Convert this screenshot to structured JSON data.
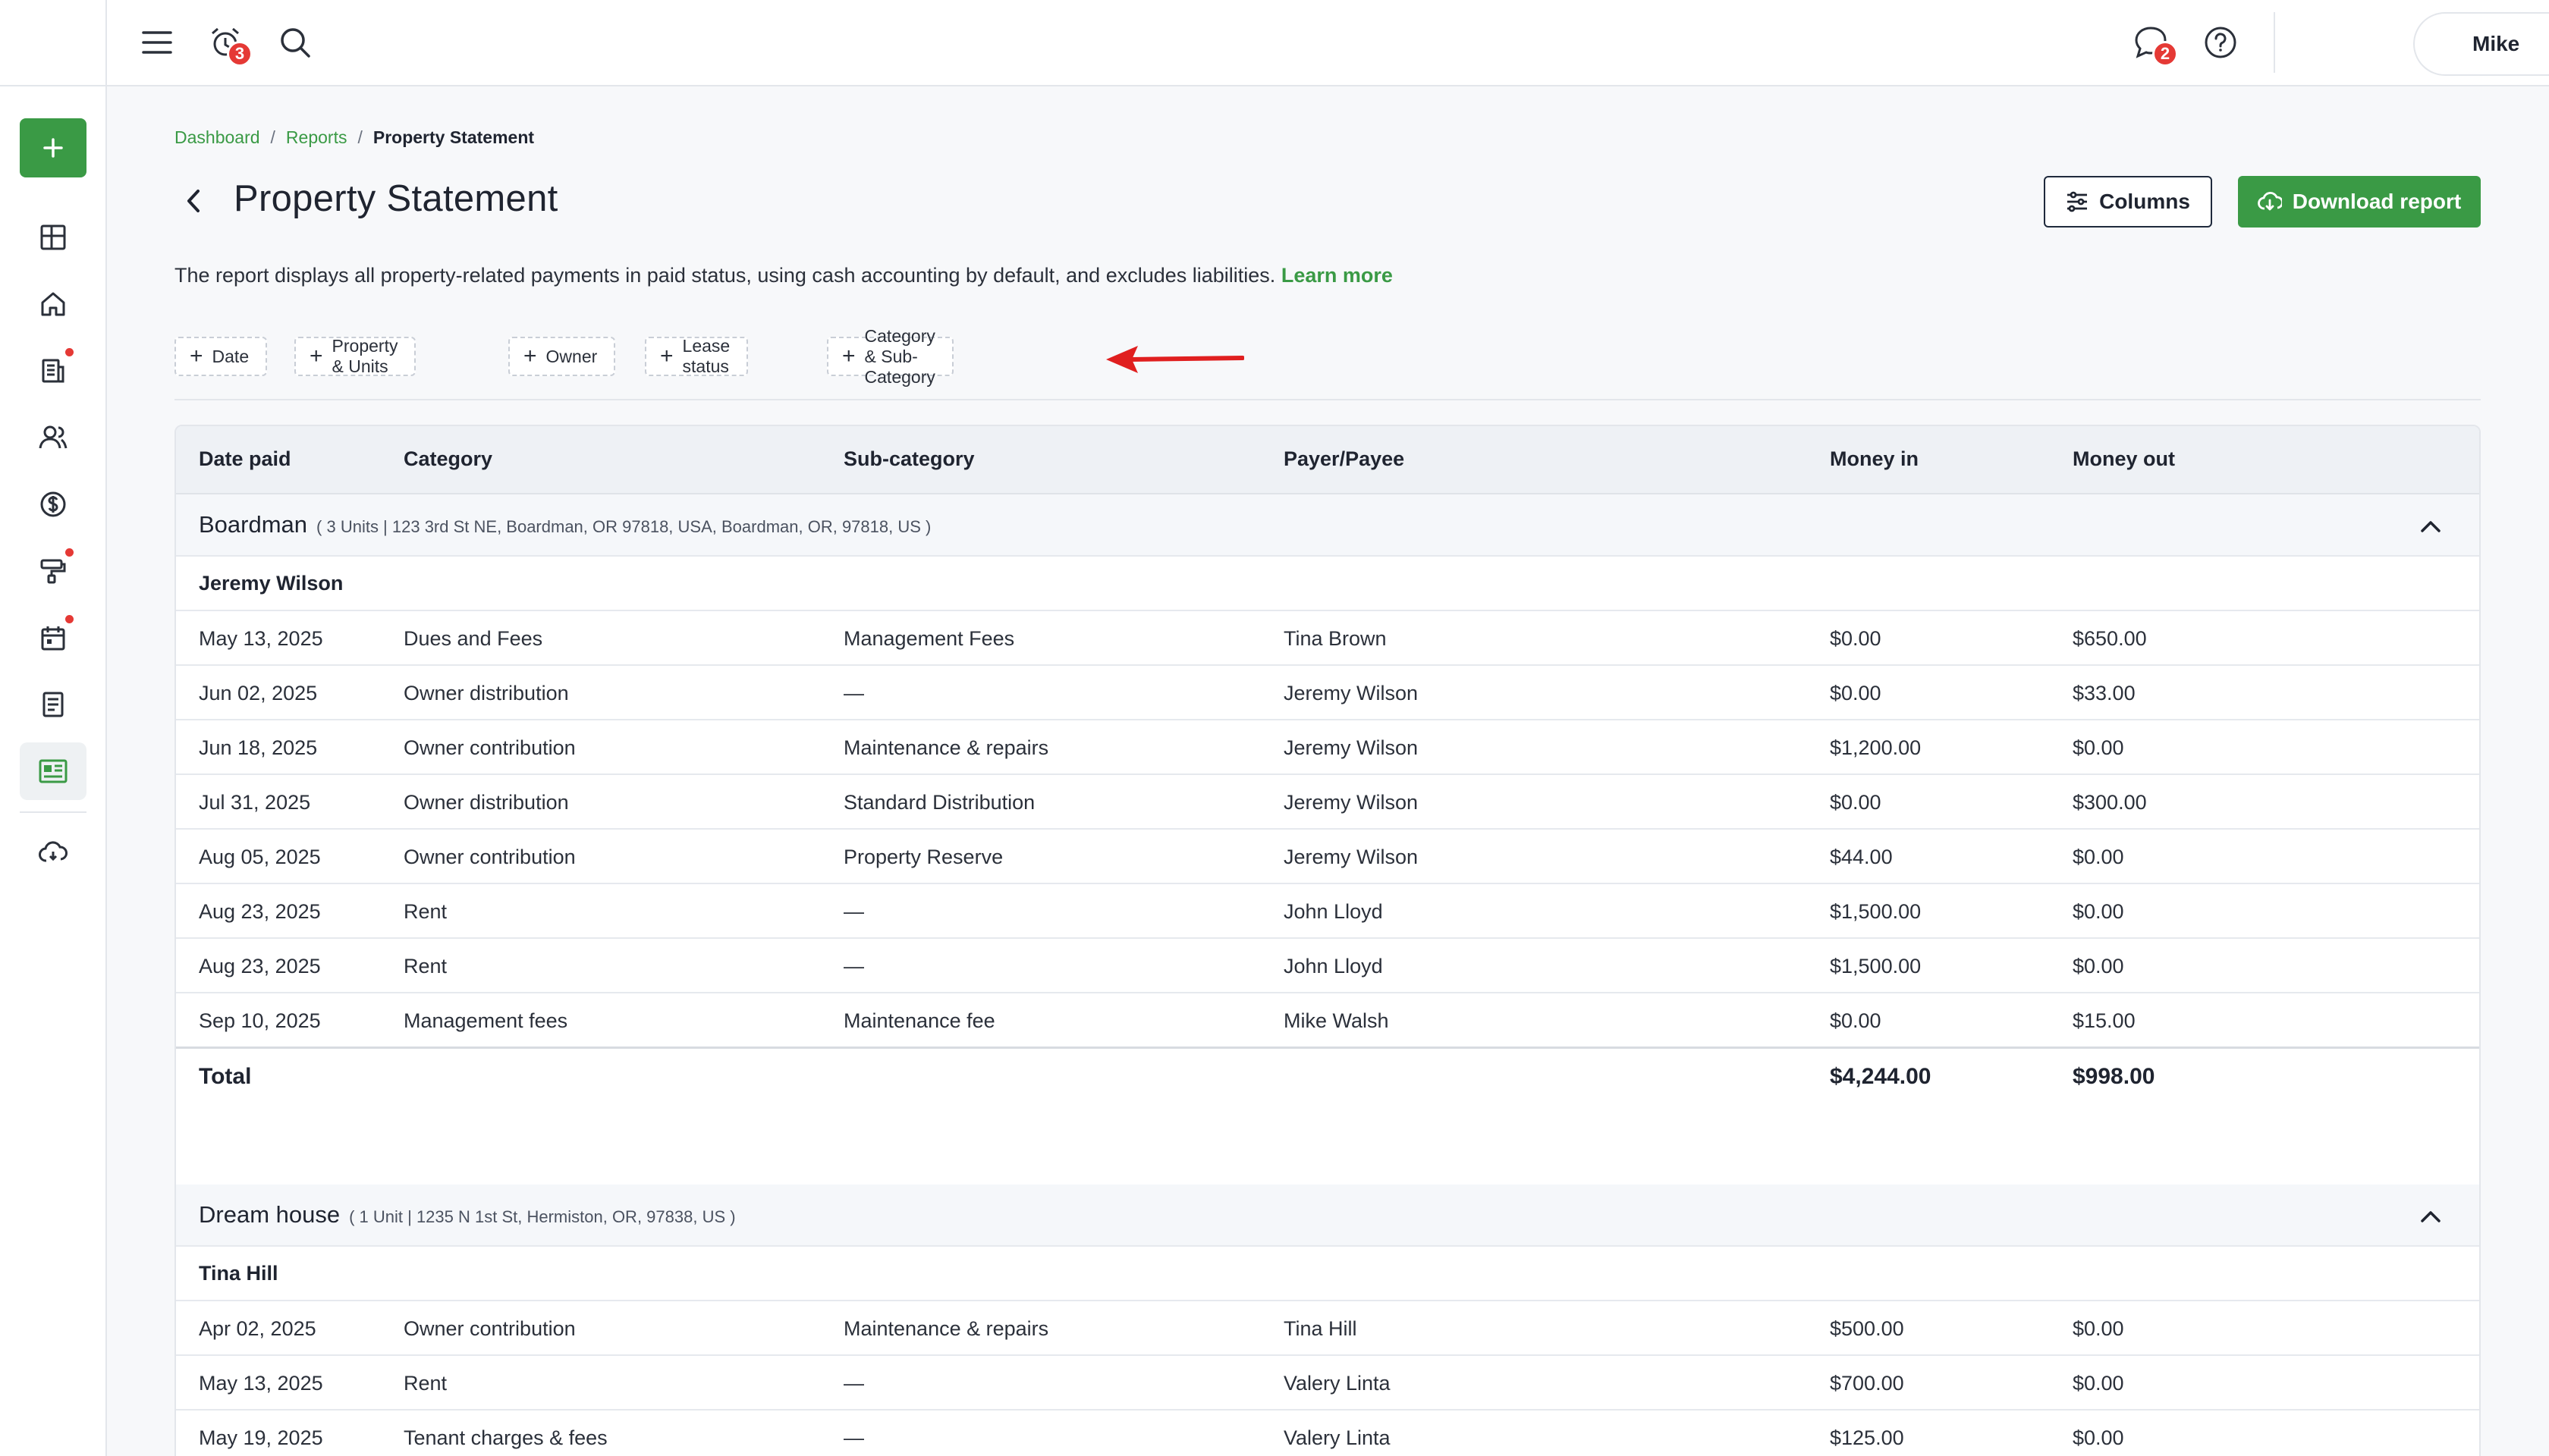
{
  "topbar": {
    "notifications_badge": "3",
    "messages_badge": "2",
    "user_name": "Mike"
  },
  "breadcrumb": {
    "items": [
      "Dashboard",
      "Reports"
    ],
    "separator": "/",
    "current": "Property Statement"
  },
  "page": {
    "title": "Property Statement",
    "description": "The report displays all property-related payments in paid status, using cash accounting by default, and excludes liabilities.",
    "learn_more": "Learn more",
    "columns_button": "Columns",
    "download_button": "Download report"
  },
  "filters": [
    "Date",
    "Property & Units",
    "Owner",
    "Lease status",
    "Category & Sub-Category"
  ],
  "table": {
    "headers": [
      "Date paid",
      "Category",
      "Sub-category",
      "Payer/Payee",
      "Money in",
      "Money out"
    ],
    "groups": [
      {
        "name": "Boardman",
        "address": "( 3 Units | 123 3rd St NE, Boardman, OR 97818, USA, Boardman, OR, 97818, US )",
        "owner": "Jeremy Wilson",
        "rows": [
          [
            "May 13, 2025",
            "Dues and Fees",
            "Management Fees",
            "Tina Brown",
            "$0.00",
            "$650.00"
          ],
          [
            "Jun 02, 2025",
            "Owner distribution",
            "—",
            "Jeremy Wilson",
            "$0.00",
            "$33.00"
          ],
          [
            "Jun 18, 2025",
            "Owner contribution",
            "Maintenance & repairs",
            "Jeremy Wilson",
            "$1,200.00",
            "$0.00"
          ],
          [
            "Jul 31, 2025",
            "Owner distribution",
            "Standard Distribution",
            "Jeremy Wilson",
            "$0.00",
            "$300.00"
          ],
          [
            "Aug 05, 2025",
            "Owner contribution",
            "Property Reserve",
            "Jeremy Wilson",
            "$44.00",
            "$0.00"
          ],
          [
            "Aug 23, 2025",
            "Rent",
            "—",
            "John Lloyd",
            "$1,500.00",
            "$0.00"
          ],
          [
            "Aug 23, 2025",
            "Rent",
            "—",
            "John Lloyd",
            "$1,500.00",
            "$0.00"
          ],
          [
            "Sep 10, 2025",
            "Management fees",
            "Maintenance fee",
            "Mike Walsh",
            "$0.00",
            "$15.00"
          ]
        ],
        "total_label": "Total",
        "total_in": "$4,244.00",
        "total_out": "$998.00"
      },
      {
        "name": "Dream house",
        "address": "( 1 Unit | 1235 N 1st St, Hermiston, OR, 97838, US )",
        "owner": "Tina Hill",
        "rows": [
          [
            "Apr 02, 2025",
            "Owner contribution",
            "Maintenance & repairs",
            "Tina Hill",
            "$500.00",
            "$0.00"
          ],
          [
            "May 13, 2025",
            "Rent",
            "—",
            "Valery Linta",
            "$700.00",
            "$0.00"
          ],
          [
            "May 19, 2025",
            "Tenant charges & fees",
            "—",
            "Valery Linta",
            "$125.00",
            "$0.00"
          ]
        ]
      }
    ]
  },
  "colors": {
    "accent": "#3a9a45",
    "badge": "#e53935",
    "annotation_arrow": "#e01f1f"
  }
}
